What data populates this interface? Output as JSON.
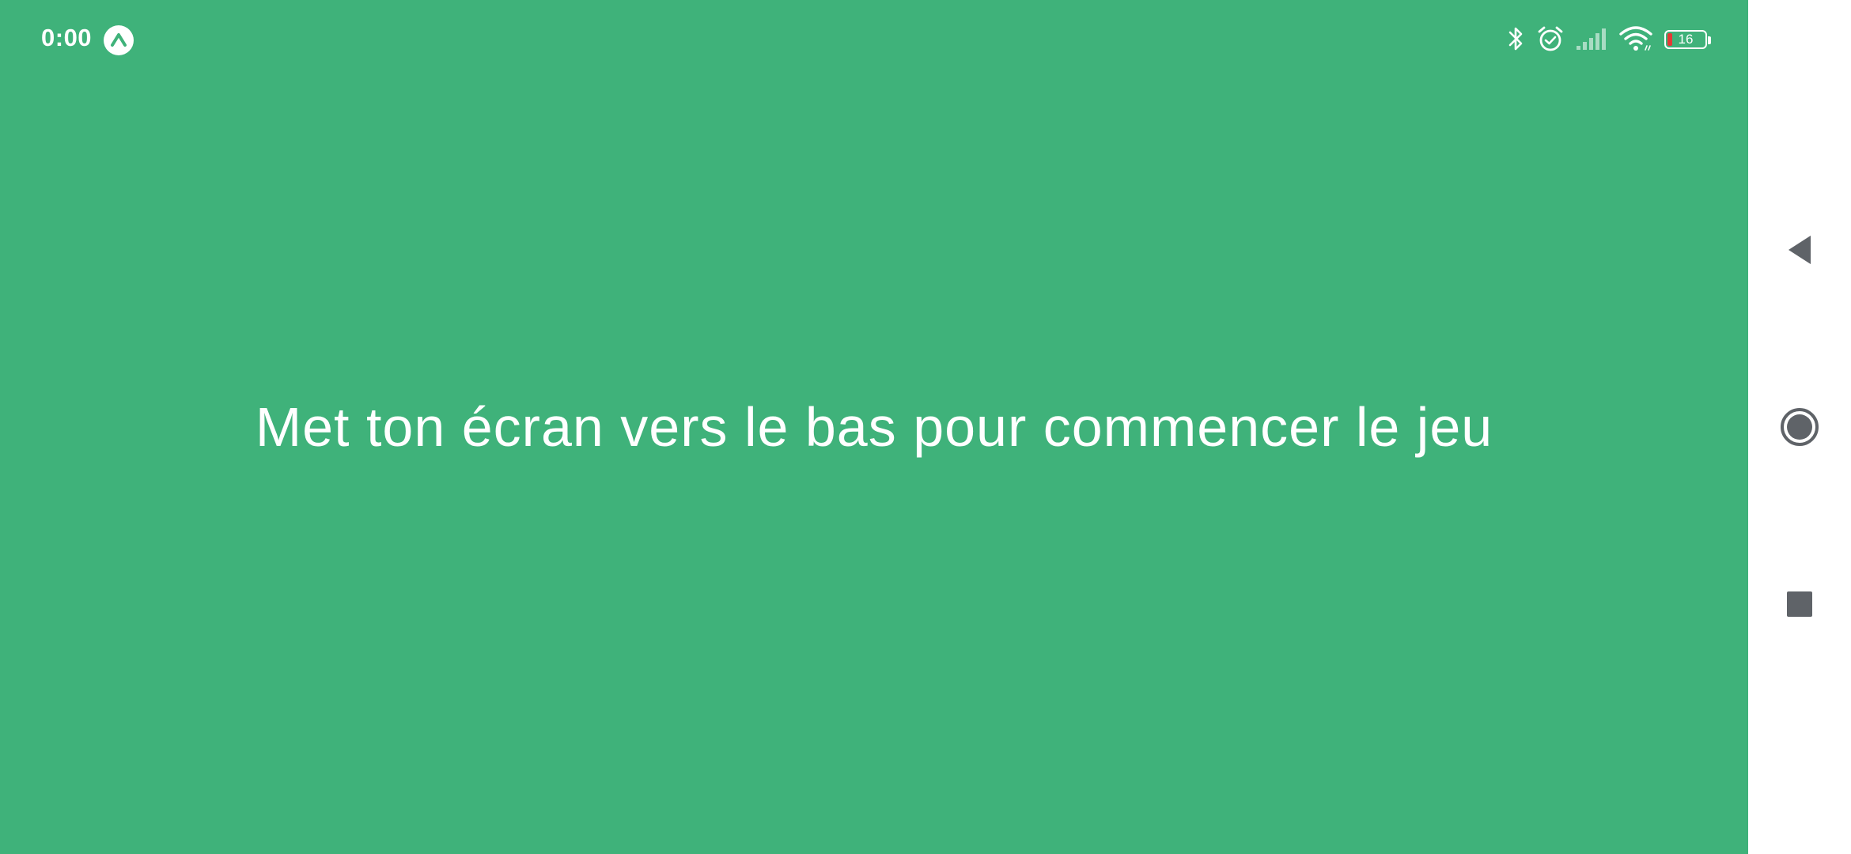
{
  "status_bar": {
    "time": "0:00",
    "notification_icon": "arrow-up-badge-icon",
    "icons": [
      "bluetooth-icon",
      "alarm-icon",
      "signal-icon",
      "wifi-icon",
      "battery-icon"
    ],
    "battery_level": "16",
    "battery_color": "#e53935"
  },
  "main": {
    "message": "Met ton écran vers le bas pour commencer le jeu",
    "background_color": "#3fb27a"
  },
  "nav_bar": {
    "buttons": [
      "back-icon",
      "home-icon",
      "recent-apps-icon"
    ]
  }
}
